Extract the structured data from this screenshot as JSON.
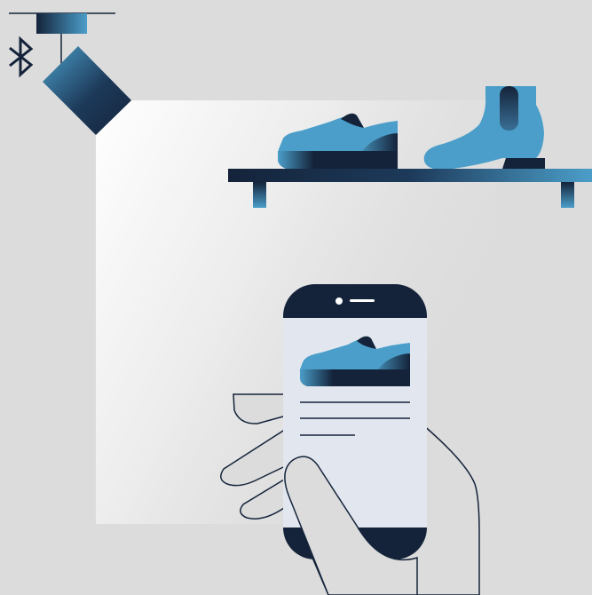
{
  "scene": {
    "description_icons": [
      "bluetooth-icon",
      "spotlight",
      "shelf",
      "sneaker",
      "chelsea-boot",
      "smartphone",
      "hand"
    ]
  },
  "colors": {
    "background": "#dcdcdc",
    "navy": "#14233a",
    "blue": "#4b9ec9",
    "light_blue": "#5fb0d8",
    "screen": "#e2e7ef",
    "outline": "#14233a",
    "hand_fill": "#dcdcdc"
  },
  "phone": {
    "screen_lines": 3
  }
}
